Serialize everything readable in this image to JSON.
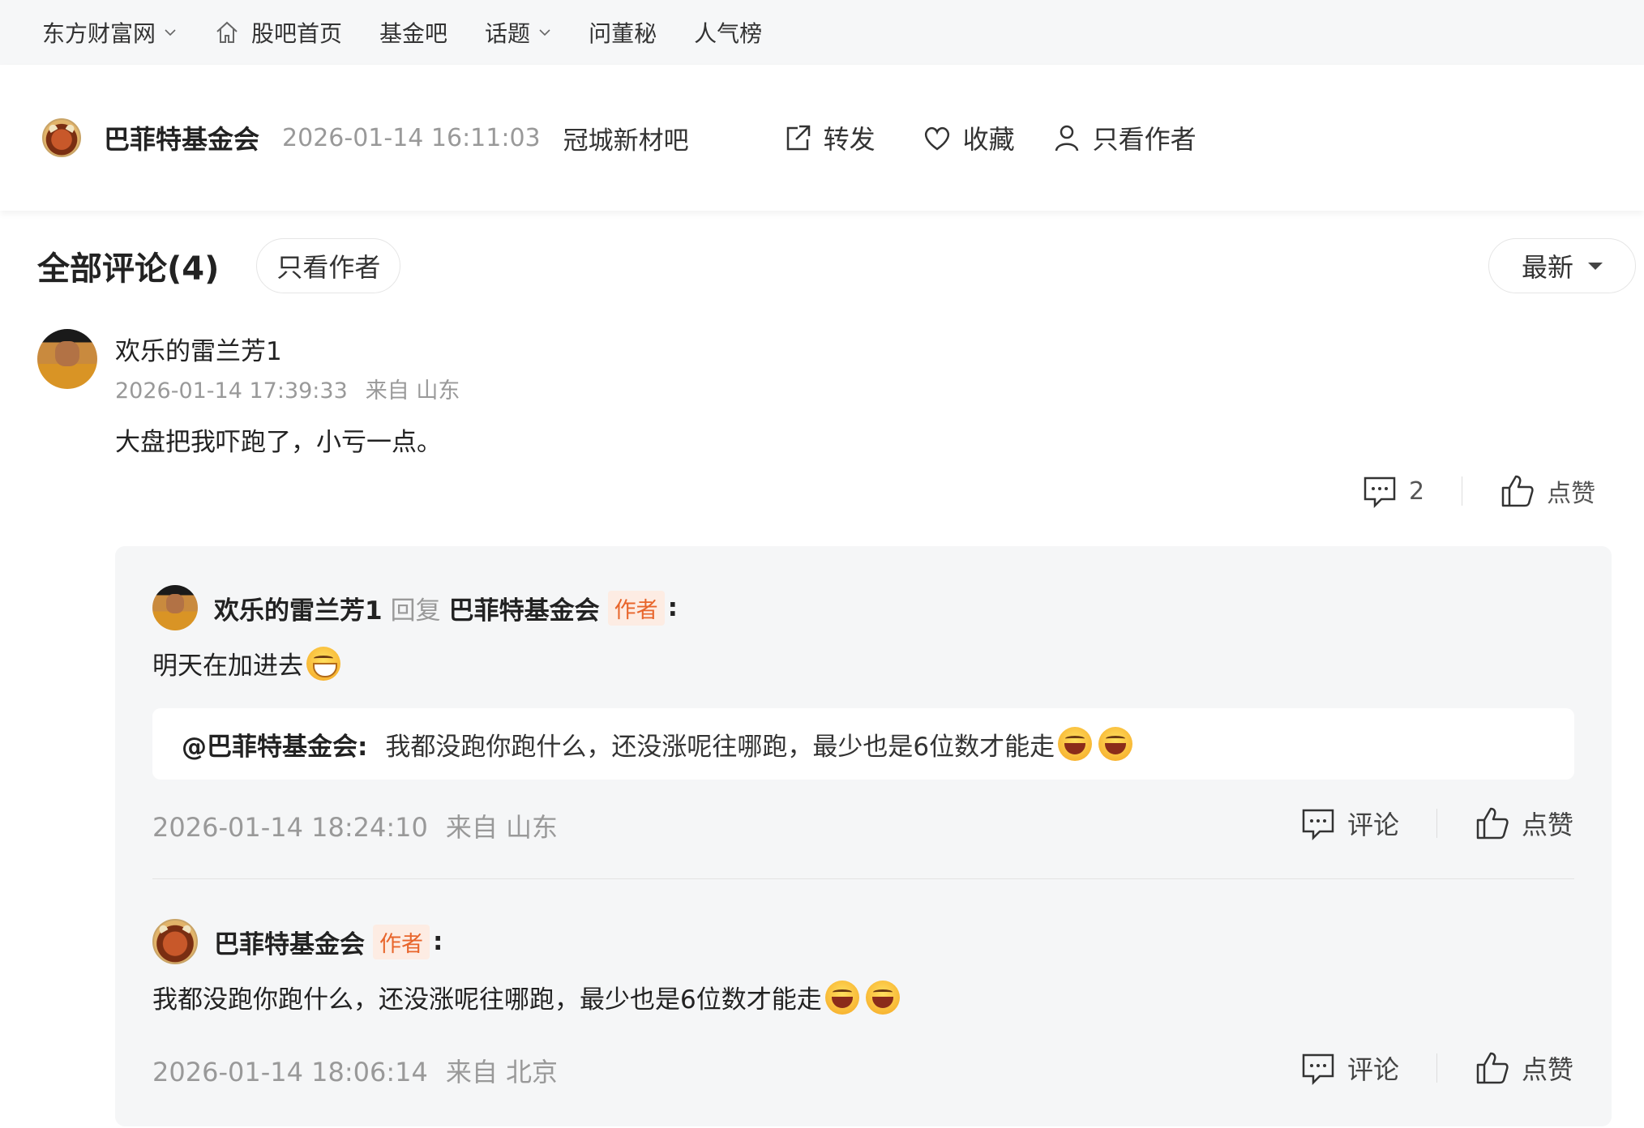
{
  "topnav": {
    "site": "东方财富网",
    "home": "股吧首页",
    "fund": "基金吧",
    "topics": "话题",
    "secretary": "问董秘",
    "popular": "人气榜"
  },
  "post": {
    "author": "巴菲特基金会",
    "time": "2026-01-14 16:11:03",
    "bar": "冠城新材吧",
    "share_label": "转发",
    "fav_label": "收藏",
    "only_author_label": "只看作者"
  },
  "comments_header": {
    "title": "全部评论(4)",
    "only_author": "只看作者",
    "sort": "最新"
  },
  "comment1": {
    "user": "欢乐的雷兰芳1",
    "time": "2026-01-14 17:39:33",
    "location": "来自 山东",
    "text": "大盘把我吓跑了，小亏一点。",
    "reply_count": "2",
    "like_label": "点赞"
  },
  "reply1": {
    "user": "欢乐的雷兰芳1",
    "reply_word": "回复",
    "target": "巴菲特基金会",
    "author_tag": "作者",
    "colon": ":",
    "text": "明天在加进去",
    "quote_user": "@巴菲特基金会:",
    "quote_text": "我都没跑你跑什么，还没涨呢往哪跑，最少也是6位数才能走",
    "time": "2026-01-14 18:24:10",
    "location": "来自 山东",
    "comment_label": "评论",
    "like_label": "点赞"
  },
  "reply2": {
    "user": "巴菲特基金会",
    "author_tag": "作者",
    "colon": ":",
    "text": "我都没跑你跑什么，还没涨呢往哪跑，最少也是6位数才能走",
    "time": "2026-01-14 18:06:14",
    "location": "来自 北京",
    "comment_label": "评论",
    "like_label": "点赞"
  },
  "colors": {
    "accent": "#e8652b",
    "muted": "#999999",
    "reply_bg": "#f5f6f7"
  }
}
